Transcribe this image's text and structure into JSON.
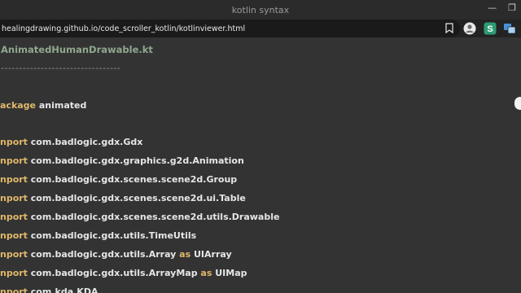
{
  "window": {
    "title": "kotlin syntax"
  },
  "toolbar": {
    "url": "healingdrawing.github.io/code_scroller_kotlin/kotlinviewer.html"
  },
  "code": {
    "filename": "AnimatedHumanDrawable.kt",
    "divider": "---------------------------------",
    "lines": [
      {
        "kw": "ackage",
        "text": " animated",
        "kw2": "",
        "text2": ""
      },
      {
        "kw": "nport",
        "text": " com.badlogic.gdx.Gdx",
        "kw2": "",
        "text2": ""
      },
      {
        "kw": "nport",
        "text": " com.badlogic.gdx.graphics.g2d.Animation",
        "kw2": "",
        "text2": ""
      },
      {
        "kw": "nport",
        "text": " com.badlogic.gdx.scenes.scene2d.Group",
        "kw2": "",
        "text2": ""
      },
      {
        "kw": "nport",
        "text": " com.badlogic.gdx.scenes.scene2d.ui.Table",
        "kw2": "",
        "text2": ""
      },
      {
        "kw": "nport",
        "text": " com.badlogic.gdx.scenes.scene2d.utils.Drawable",
        "kw2": "",
        "text2": ""
      },
      {
        "kw": "nport",
        "text": " com.badlogic.gdx.utils.TimeUtils",
        "kw2": "",
        "text2": ""
      },
      {
        "kw": "nport",
        "text": " com.badlogic.gdx.utils.Array ",
        "kw2": "as",
        "text2": " UIArray"
      },
      {
        "kw": "nport",
        "text": " com.badlogic.gdx.utils.ArrayMap ",
        "kw2": "as",
        "text2": " UIMap"
      },
      {
        "kw": "nport",
        "text": " com.kda.KDA",
        "kw2": "",
        "text2": ""
      }
    ]
  },
  "colors": {
    "background": "#333333",
    "keyword": "#e0b86a",
    "filename": "#8fa88f",
    "text": "#e6e6e6"
  }
}
